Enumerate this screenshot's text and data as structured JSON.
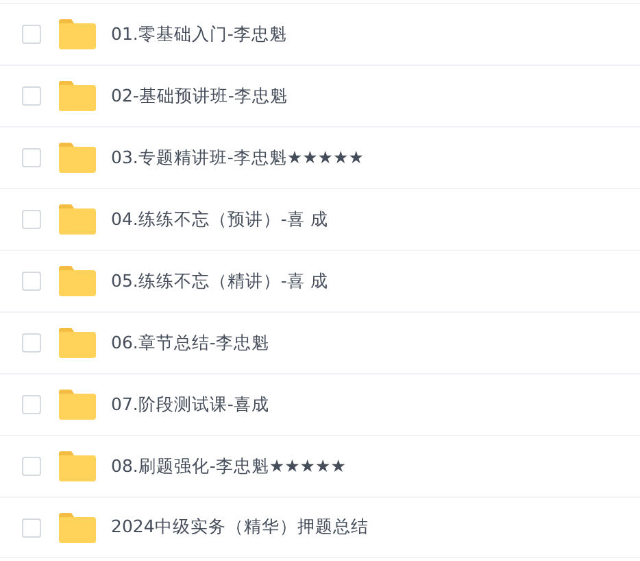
{
  "files": [
    {
      "name": "01.零基础入门-李忠魁",
      "checked": false
    },
    {
      "name": "02-基础预讲班-李忠魁",
      "checked": false
    },
    {
      "name": "03.专题精讲班-李忠魁★★★★★",
      "checked": false
    },
    {
      "name": "04.练练不忘（预讲）-喜 成",
      "checked": false
    },
    {
      "name": "05.练练不忘（精讲）-喜 成",
      "checked": false
    },
    {
      "name": "06.章节总结-李忠魁",
      "checked": false
    },
    {
      "name": "07.阶段测试课-喜成",
      "checked": false
    },
    {
      "name": "08.刷题强化-李忠魁★★★★★",
      "checked": false
    },
    {
      "name": "2024中级实务（精华）押题总结",
      "checked": false
    }
  ]
}
